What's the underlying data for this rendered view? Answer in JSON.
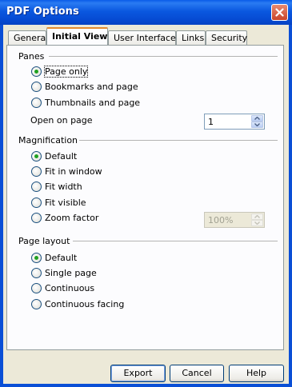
{
  "window": {
    "title": "PDF Options"
  },
  "tabs": [
    {
      "label": "General"
    },
    {
      "label": "Initial View"
    },
    {
      "label": "User Interface"
    },
    {
      "label": "Links"
    },
    {
      "label": "Security"
    }
  ],
  "panes": {
    "heading": "Panes",
    "options": [
      {
        "label": "Page only",
        "checked": true
      },
      {
        "label": "Bookmarks and page",
        "checked": false
      },
      {
        "label": "Thumbnails and page",
        "checked": false
      }
    ],
    "open_on_page_label": "Open on page",
    "open_on_page_value": "1"
  },
  "magnification": {
    "heading": "Magnification",
    "options": [
      {
        "label": "Default",
        "checked": true
      },
      {
        "label": "Fit in window",
        "checked": false
      },
      {
        "label": "Fit width",
        "checked": false
      },
      {
        "label": "Fit visible",
        "checked": false
      },
      {
        "label": "Zoom factor",
        "checked": false
      }
    ],
    "zoom_value": "100%"
  },
  "page_layout": {
    "heading": "Page layout",
    "options": [
      {
        "label": "Default",
        "checked": true
      },
      {
        "label": "Single page",
        "checked": false
      },
      {
        "label": "Continuous",
        "checked": false
      },
      {
        "label": "Continuous facing",
        "checked": false
      }
    ]
  },
  "buttons": {
    "export": "Export",
    "cancel": "Cancel",
    "help": "Help"
  }
}
